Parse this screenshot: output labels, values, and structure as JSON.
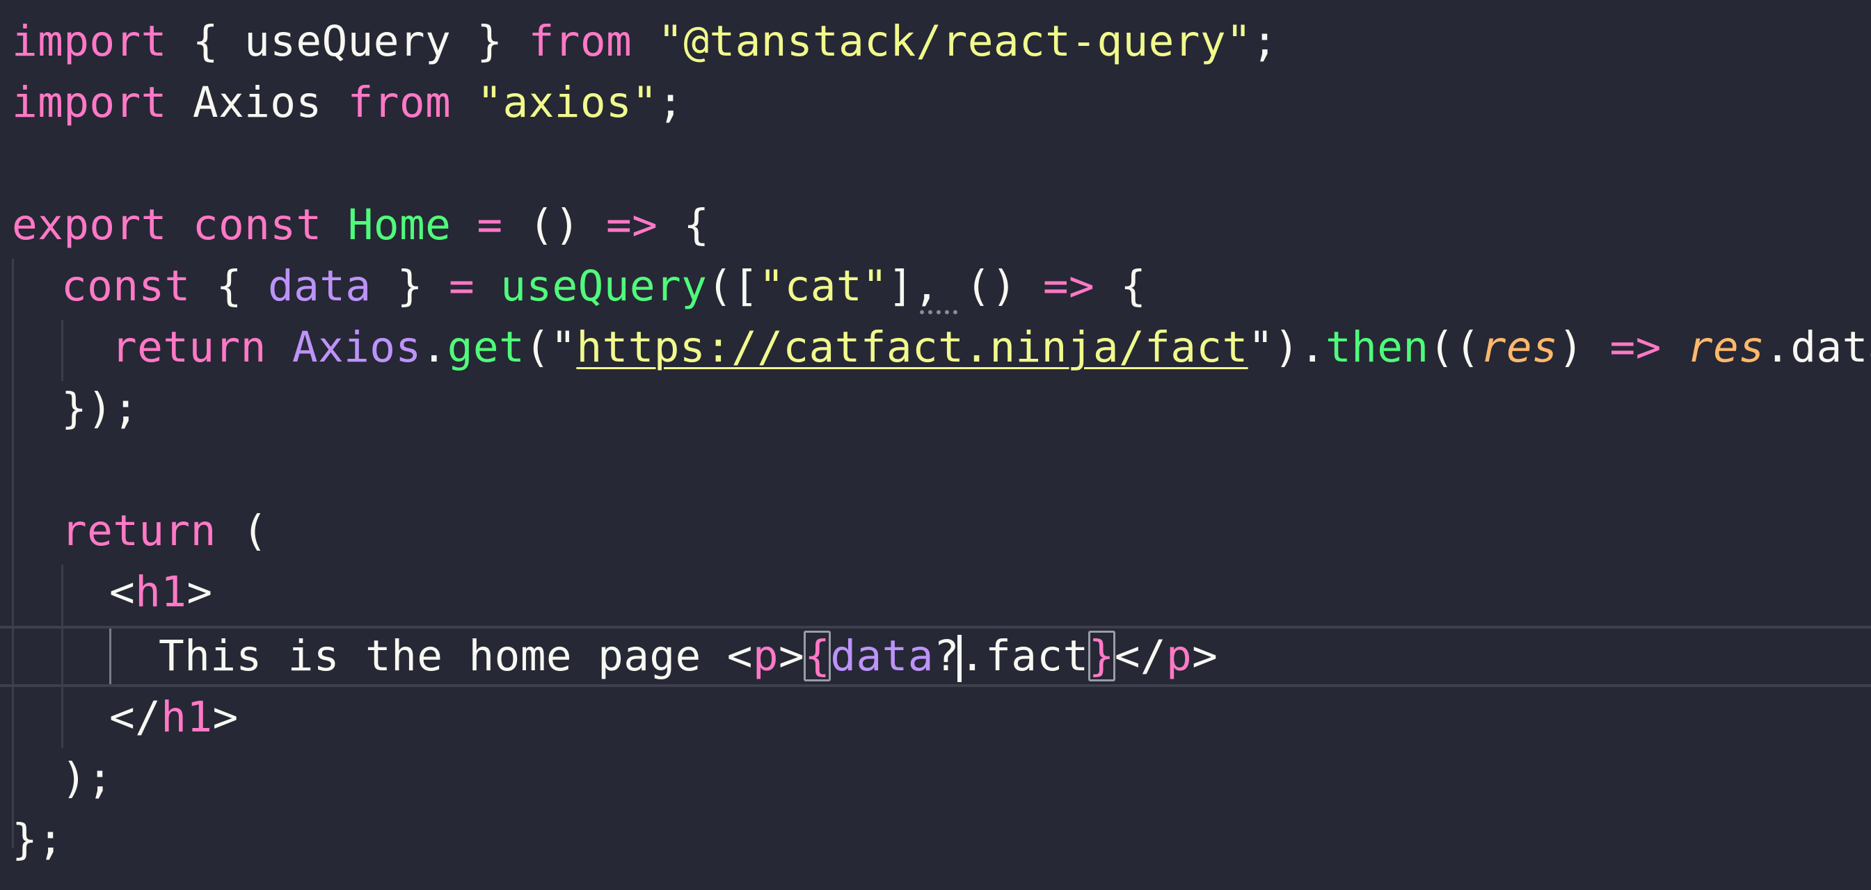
{
  "editor": {
    "lines": [
      {
        "tokens": [
          "import",
          " { ",
          "useQuery",
          " } ",
          "from",
          " ",
          "\"@tanstack/react-query\"",
          ";"
        ]
      },
      {
        "tokens": [
          "import",
          " Axios ",
          "from",
          " ",
          "\"axios\"",
          ";"
        ]
      },
      {
        "tokens": []
      },
      {
        "tokens": [
          "export",
          " ",
          "const",
          " ",
          "Home",
          " ",
          "=",
          " () ",
          "=>",
          " {"
        ]
      },
      {
        "tokens": [
          "const",
          " { ",
          "data",
          " } ",
          "=",
          " ",
          "useQuery",
          "([",
          "\"cat\"",
          "], () ",
          "=>",
          " {"
        ]
      },
      {
        "tokens": [
          "return",
          " ",
          "Axios",
          ".",
          "get",
          "(\"",
          "https://catfact.ninja/fact",
          "\").",
          "then",
          "((",
          "res",
          ") ",
          "=>",
          " ",
          "res",
          ".data);"
        ]
      },
      {
        "tokens": [
          "});"
        ]
      },
      {
        "tokens": []
      },
      {
        "tokens": [
          "return",
          " ("
        ]
      },
      {
        "tokens": [
          "<",
          "h1",
          ">"
        ]
      },
      {
        "tokens": [
          "This is the home page ",
          "<",
          "p",
          ">",
          "{",
          "data",
          "?",
          ".fact",
          "}",
          "</",
          "p",
          ">"
        ]
      },
      {
        "tokens": [
          "</",
          "h1",
          ">"
        ]
      },
      {
        "tokens": [
          ");"
        ]
      },
      {
        "tokens": [
          "};"
        ]
      }
    ]
  },
  "colors": {
    "background": "#262835",
    "keyword": "#ff79c6",
    "function": "#50fa7b",
    "string": "#f1fa8c",
    "variable": "#bd93f9",
    "parameter": "#ffb86c",
    "text": "#f8f8f2"
  }
}
